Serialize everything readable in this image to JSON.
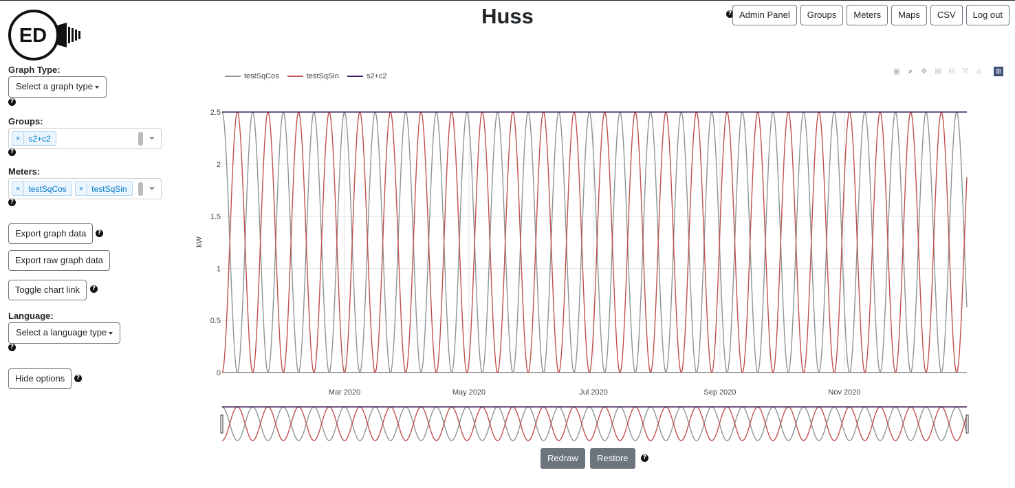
{
  "header": {
    "title": "Huss",
    "logo_text": "ED",
    "nav": [
      "Admin Panel",
      "Groups",
      "Meters",
      "Maps",
      "CSV",
      "Log out"
    ]
  },
  "sidebar": {
    "graph_type_label": "Graph Type:",
    "graph_type_value": "Select a graph type",
    "groups_label": "Groups:",
    "groups_selected": [
      "s2+c2"
    ],
    "meters_label": "Meters:",
    "meters_selected": [
      "testSqCos",
      "testSqSin"
    ],
    "export_graph": "Export graph data",
    "export_raw": "Export raw graph data",
    "toggle_link": "Toggle chart link",
    "language_label": "Language:",
    "language_value": "Select a language type",
    "hide_options": "Hide options"
  },
  "help_icon": "?",
  "controls": {
    "redraw": "Redraw",
    "restore": "Restore"
  },
  "colors": {
    "testSqCos": "#8c9594",
    "testSqSin": "#c0504d",
    "s2+c2": "#3b1f5a"
  },
  "modebar_icons": [
    "camera-icon",
    "zoom-icon",
    "pan-icon",
    "zoom-in-icon",
    "zoom-out-icon",
    "autoscale-icon",
    "reset-axes-icon",
    "plotly-logo-icon"
  ],
  "chart_data": {
    "type": "line",
    "ylabel": "kW",
    "ylim": [
      0,
      2.5
    ],
    "yticks": [
      "0",
      "0.5",
      "1",
      "1.5",
      "2",
      "2.5"
    ],
    "xticks": [
      "Mar 2020",
      "May 2020",
      "Jul 2020",
      "Sep 2020",
      "Nov 2020"
    ],
    "x_range": [
      "2020-01-01",
      "2020-12-31"
    ],
    "period_days": 15,
    "series": [
      {
        "name": "testSqCos",
        "formula": "2.5*cos^2(pi*t/period)",
        "min": 0,
        "max": 2.5
      },
      {
        "name": "testSqSin",
        "formula": "2.5*sin^2(pi*t/period)",
        "min": 0,
        "max": 2.5
      },
      {
        "name": "s2+c2",
        "formula": "constant",
        "values": [
          2.5
        ]
      }
    ],
    "grid": true,
    "legend": "top-left",
    "range_slider": true
  }
}
